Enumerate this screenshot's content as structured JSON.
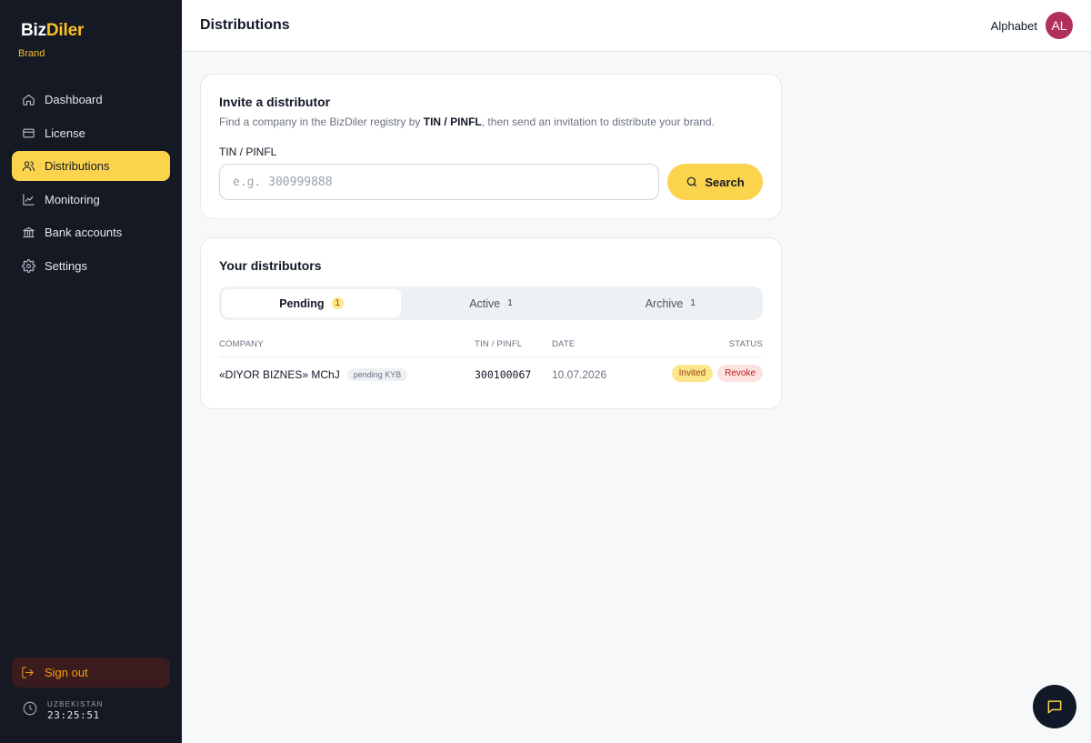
{
  "brand": {
    "name_part1": "Biz",
    "name_part2": "Diler",
    "role": "Brand"
  },
  "sidebar": {
    "items": [
      {
        "label": "Dashboard",
        "icon": "home-icon",
        "active": false
      },
      {
        "label": "License",
        "icon": "card-icon",
        "active": false
      },
      {
        "label": "Distributions",
        "icon": "users-icon",
        "active": true
      },
      {
        "label": "Monitoring",
        "icon": "chart-icon",
        "active": false
      },
      {
        "label": "Bank accounts",
        "icon": "bank-icon",
        "active": false
      },
      {
        "label": "Settings",
        "icon": "gear-icon",
        "active": false
      }
    ],
    "sign_out": "Sign out",
    "clock": {
      "country": "UZBEKISTAN",
      "time": "23:25:51"
    }
  },
  "header": {
    "title": "Distributions",
    "org_name": "Alphabet",
    "avatar_initials": "AL"
  },
  "invite": {
    "title": "Invite a distributor",
    "desc_prefix": "Find a company in the BizDiler registry by ",
    "desc_bold": "TIN / PINFL",
    "desc_suffix": ", then send an invitation to distribute your brand.",
    "field_label": "TIN / PINFL",
    "placeholder": "e.g. 300999888",
    "value": "",
    "search_label": "Search"
  },
  "distributors": {
    "title": "Your distributors",
    "tabs": [
      {
        "label": "Pending",
        "count": "1",
        "active": true
      },
      {
        "label": "Active",
        "count": "1",
        "active": false
      },
      {
        "label": "Archive",
        "count": "1",
        "active": false
      }
    ],
    "columns": {
      "company": "COMPANY",
      "tin": "TIN / PINFL",
      "date": "DATE",
      "status": "STATUS"
    },
    "rows": [
      {
        "company": "«DIYOR BIZNES» MChJ",
        "badge": "pending KYB",
        "tin": "300100067",
        "date": "10.07.2026",
        "status": "Invited",
        "action": "Revoke"
      }
    ]
  },
  "colors": {
    "accent": "#fcd34d",
    "sidebar_bg": "#141923",
    "avatar": "#b0305a"
  }
}
